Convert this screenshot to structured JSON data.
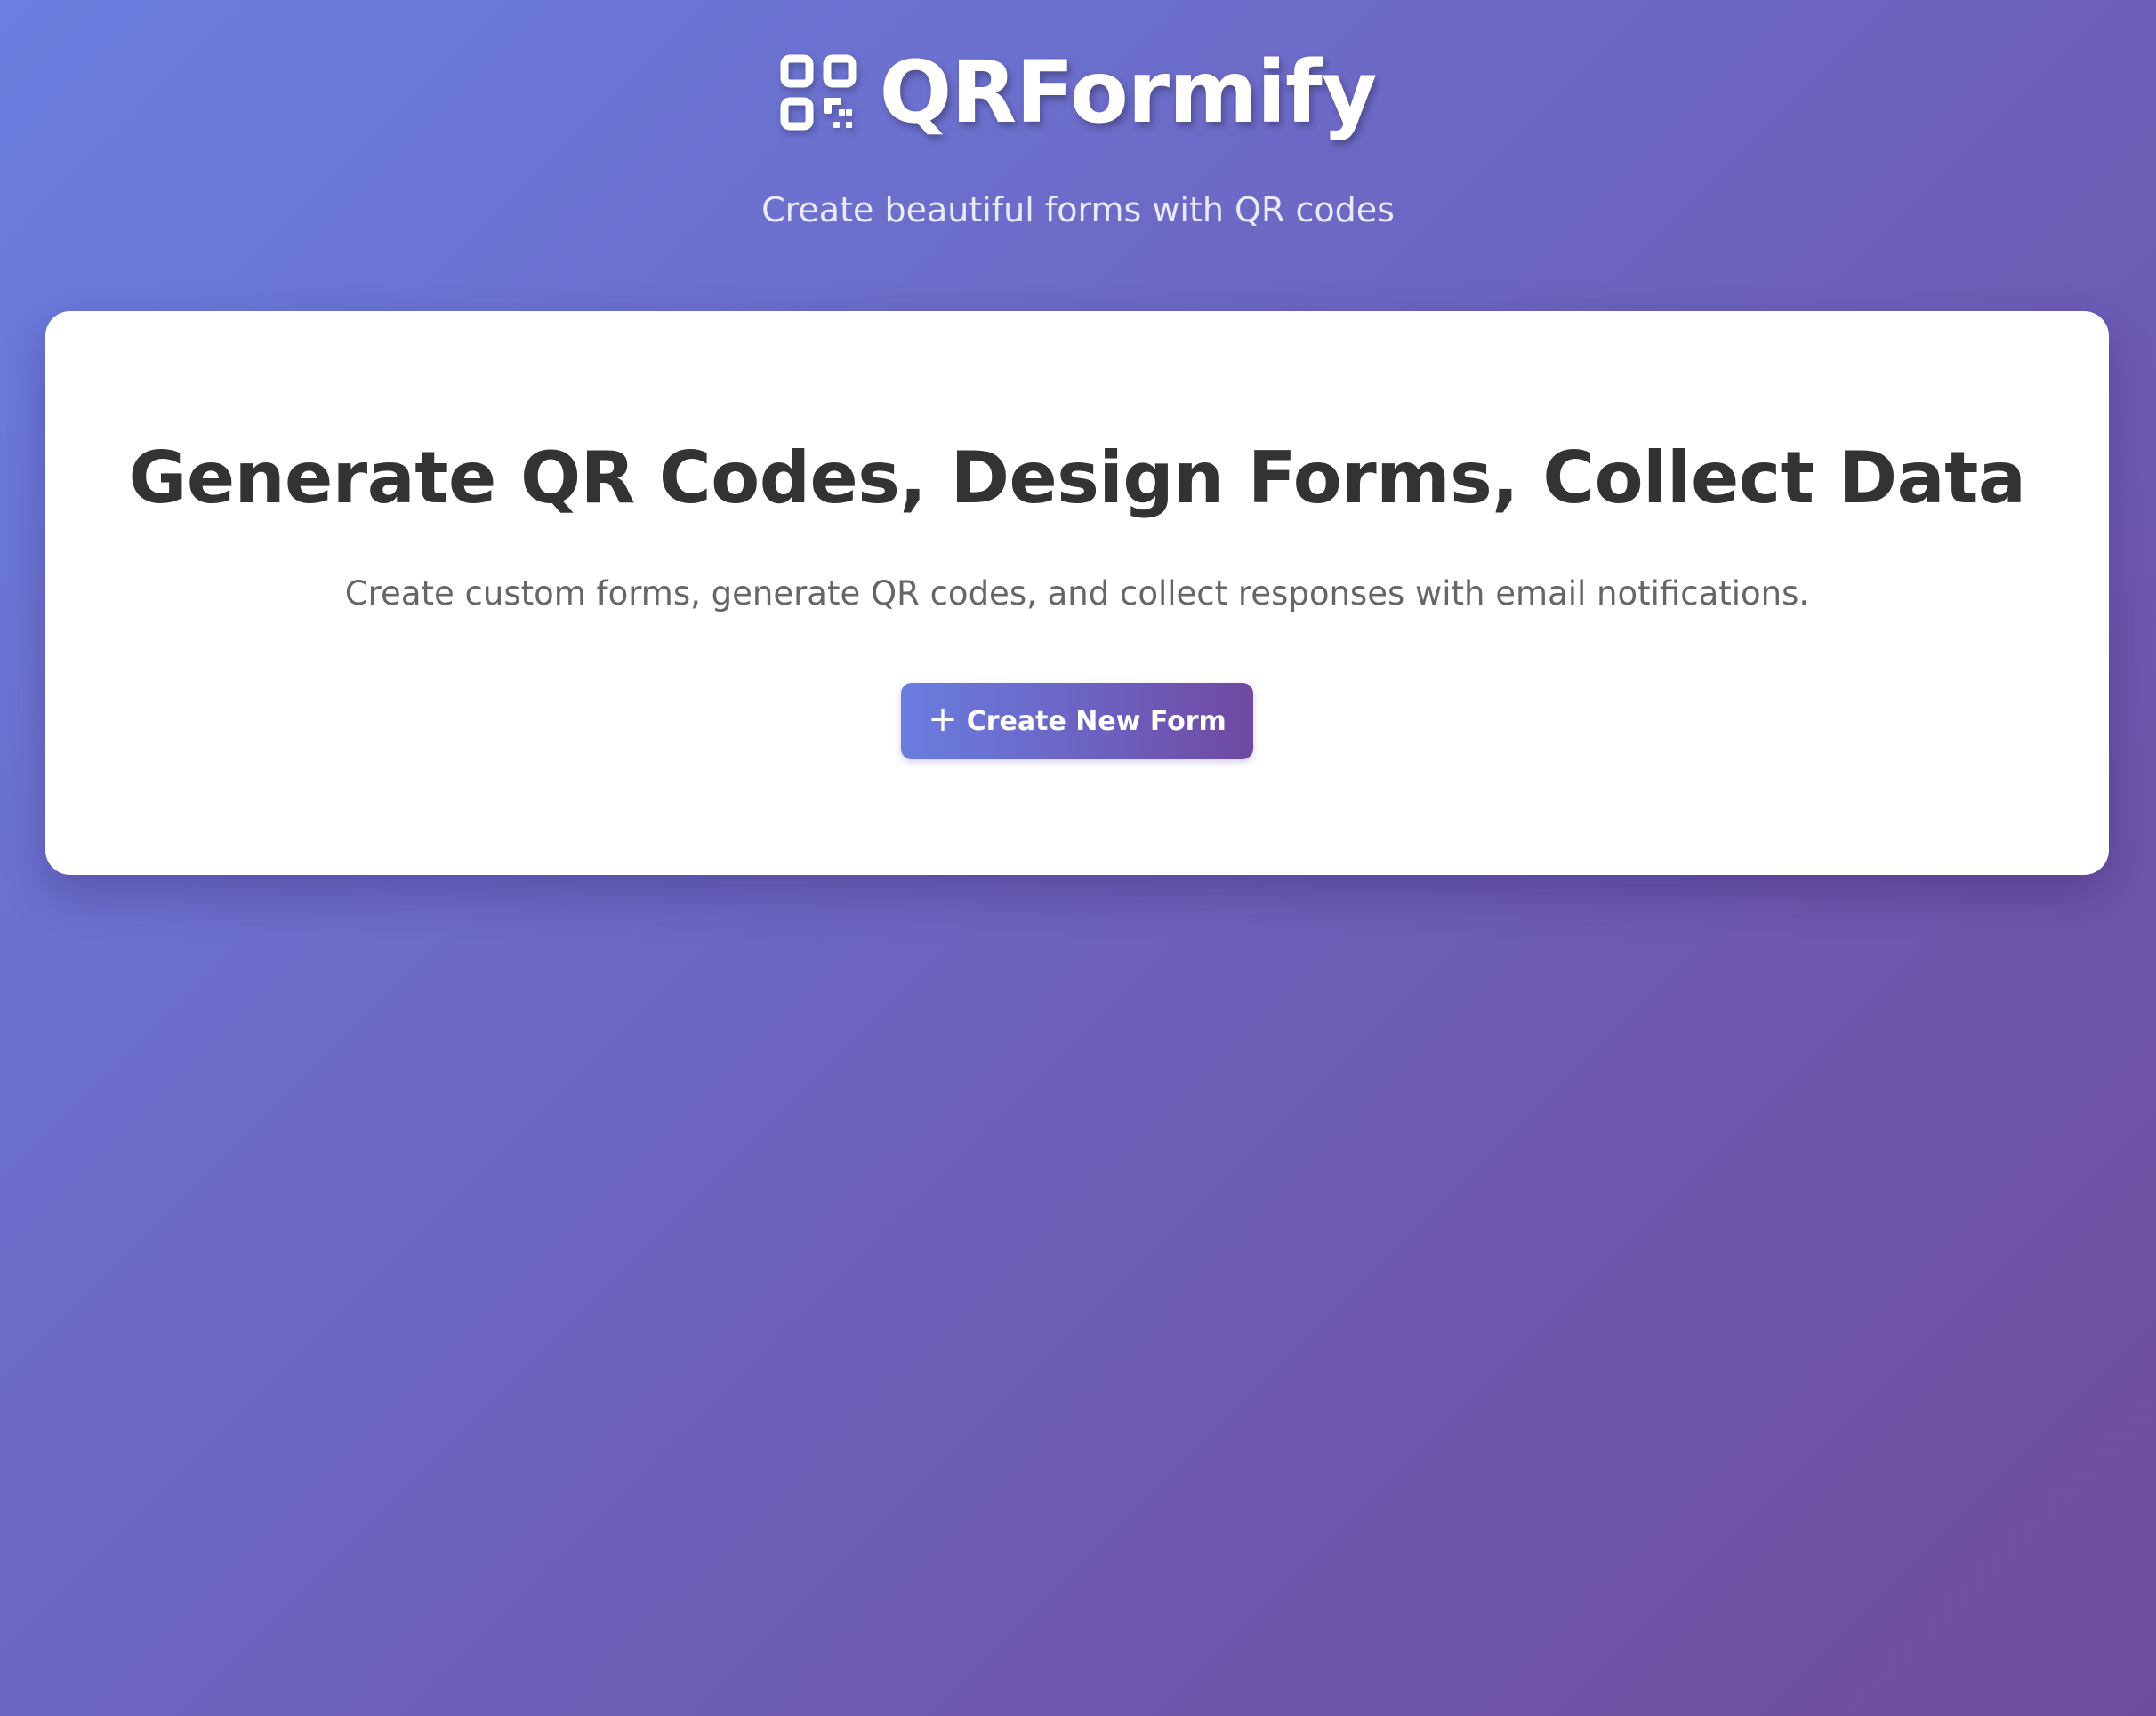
{
  "header": {
    "logo_icon": "qrcode-icon",
    "brand_name": "QRFormify",
    "tagline": "Create beautiful forms with QR codes"
  },
  "hero": {
    "title": "Generate QR Codes, Design Forms, Collect Data",
    "subtitle": "Create custom forms, generate QR codes, and collect responses with email notifications.",
    "cta": {
      "icon": "plus-icon",
      "icon_glyph": "+",
      "label": "Create New Form"
    }
  },
  "colors": {
    "background_gradient_start": "#6b7fe0",
    "background_gradient_end": "#6f4d9c",
    "card_background": "#ffffff",
    "title_text": "#333333",
    "subtitle_text": "#666666",
    "button_gradient_start": "#6a7ee0",
    "button_gradient_end": "#7049a0"
  }
}
